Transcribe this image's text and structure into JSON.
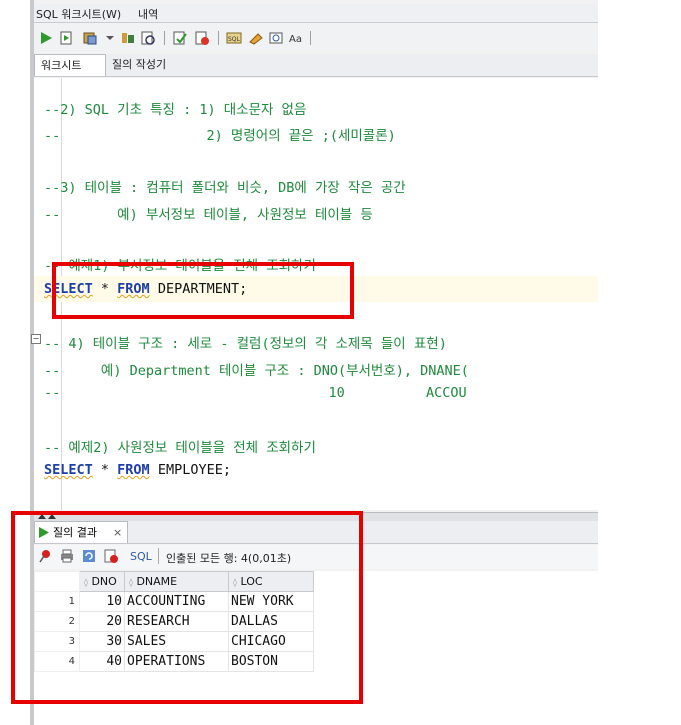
{
  "window": {
    "tab_title": "SQL 워크시트(W)",
    "tab_history": "내역"
  },
  "toolbar": {
    "icons": [
      "run-statement-icon",
      "run-script-icon",
      "autotrace-icon",
      "explain-plan-icon",
      "sql-tuning-icon",
      "commit-icon",
      "rollback-icon",
      "unshared-sql-icon",
      "clear-icon",
      "history-icon",
      "format-icon"
    ]
  },
  "worksheet_tabs": {
    "worksheet": "워크시트",
    "query_builder": "질의 작성기"
  },
  "editor": {
    "lines": [
      {
        "text": "--2) SQL 기초 특징 : 1) 대소문자 없음"
      },
      {
        "text": "--                  2) 명령어의 끝은 ;(세미콜론)"
      },
      {
        "text": "--3) 테이블 : 컴퓨터 폴더와 비슷, DB에 가장 작은 공간"
      },
      {
        "text": "--       예) 부서정보 테이블, 사원정보 테이블 등"
      },
      {
        "text": "-- 예제1) 부서정보 테이블을 전체 조회하기"
      },
      {
        "kw1": "SELECT",
        "mid": " * ",
        "kw2": "FROM",
        "rest": " DEPARTMENT;"
      },
      {
        "text": "-- 4) 테이블 구조 : 세로 - 컬럼(정보의 각 소제목 들이 표현)"
      },
      {
        "text": "--     예) Department 테이블 구조 : DNO(부서번호), DNANE("
      },
      {
        "text": "--                                 10          ACCOU"
      },
      {
        "text": "-- 예제2) 사원정보 테이블을 전체 조회하기"
      },
      {
        "kw1": "SELECT",
        "mid": " * ",
        "kw2": "FROM",
        "rest": " EMPLOYEE;"
      }
    ]
  },
  "results": {
    "tab_label": "질의 결과",
    "close_glyph": "×",
    "sql_label": "SQL",
    "status": "인출된 모든 행: 4(0,01초)",
    "columns": [
      "DNO",
      "DNAME",
      "LOC"
    ],
    "rows": [
      {
        "n": "1",
        "dno": "10",
        "dname": "ACCOUNTING",
        "loc": "NEW YORK"
      },
      {
        "n": "2",
        "dno": "20",
        "dname": "RESEARCH",
        "loc": "DALLAS"
      },
      {
        "n": "3",
        "dno": "30",
        "dname": "SALES",
        "loc": "CHICAGO"
      },
      {
        "n": "4",
        "dno": "40",
        "dname": "OPERATIONS",
        "loc": "BOSTON"
      }
    ]
  },
  "colors": {
    "highlight": "#e60000",
    "comment": "#1f8a3c",
    "keyword": "#1c3fa8"
  }
}
